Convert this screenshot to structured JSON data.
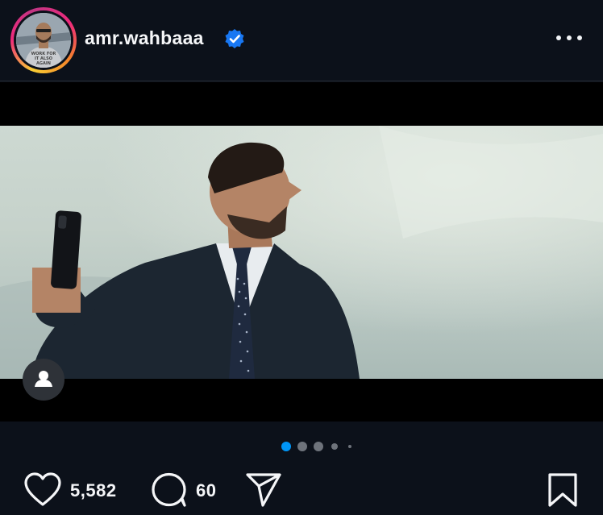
{
  "post": {
    "username": "amr.wahbaaa",
    "verified": true,
    "avatar_shirt_text": "WORK FOR IT / ALSO WORK FOR IT / AGAIN"
  },
  "media": {
    "carousel": {
      "total_slides": 5,
      "active_index": 0
    }
  },
  "actions": {
    "likes": "5,582",
    "comments": "60"
  },
  "icons": {
    "more": "more-options-icon",
    "verified": "verified-badge-icon",
    "user_tag": "user-tag-icon",
    "like": "heart-icon",
    "comment": "comment-bubble-icon",
    "share": "send-icon",
    "save": "bookmark-icon"
  },
  "colors": {
    "background": "#0c111a",
    "accent": "#0095f6",
    "verified": "#1877f2",
    "text": "#f5f6f8"
  }
}
